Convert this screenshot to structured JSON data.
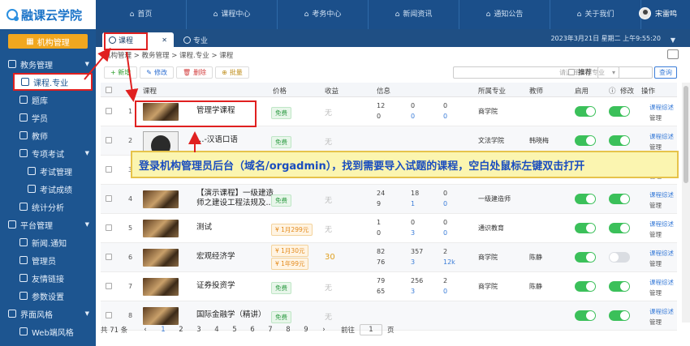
{
  "logo": {
    "text": "融课云学院"
  },
  "topnav": [
    {
      "label": "首页",
      "icon": "home-icon"
    },
    {
      "label": "课程中心",
      "icon": "gear-icon"
    },
    {
      "label": "考务中心",
      "icon": "exam-icon"
    },
    {
      "label": "新闻资讯",
      "icon": "news-icon"
    },
    {
      "label": "通知公告",
      "icon": "chat-icon"
    },
    {
      "label": "关于我们",
      "icon": "info-icon"
    }
  ],
  "user": {
    "name": "宋雷鸣"
  },
  "sidebar": {
    "org_button": "机构管理",
    "items": [
      {
        "label": "教务管理",
        "level": 1,
        "icon": "chart-icon",
        "caret": "▼"
      },
      {
        "label": "课程.专业",
        "level": 2,
        "icon": "book-icon",
        "active": true
      },
      {
        "label": "题库",
        "level": 2,
        "icon": "list-icon"
      },
      {
        "label": "学员",
        "level": 2,
        "icon": "user-icon"
      },
      {
        "label": "教师",
        "level": 2,
        "icon": "teacher-icon"
      },
      {
        "label": "专项考试",
        "level": 2,
        "icon": "exam-icon",
        "caret": "▼"
      },
      {
        "label": "考试管理",
        "level": 3,
        "icon": "doc-icon"
      },
      {
        "label": "考试成绩",
        "level": 3,
        "icon": "score-icon"
      },
      {
        "label": "统计分析",
        "level": 2,
        "icon": "stats-icon"
      },
      {
        "label": "平台管理",
        "level": 1,
        "icon": "list-icon",
        "caret": "▼"
      },
      {
        "label": "新闻.通知",
        "level": 2,
        "icon": "news-icon"
      },
      {
        "label": "管理员",
        "level": 2,
        "icon": "admin-icon"
      },
      {
        "label": "友情链接",
        "level": 2,
        "icon": "link-icon"
      },
      {
        "label": "参数设置",
        "level": 2,
        "icon": "gear-icon"
      },
      {
        "label": "界面风格",
        "level": 1,
        "icon": "ui-icon",
        "caret": "▼"
      },
      {
        "label": "Web端风格",
        "level": 2,
        "icon": "monitor-icon"
      }
    ]
  },
  "tabs": [
    {
      "label": "课程",
      "active": true
    },
    {
      "label": "专业",
      "active": false
    }
  ],
  "datetime": "2023年3月21日 星期二 上午9:55:20",
  "breadcrumb": "机构管理 > 教务管理 > 课程.专业 > 课程",
  "toolbar": {
    "add": "+ 新增",
    "edit": "修改",
    "delete": "删除",
    "batch": "批量",
    "major_placeholder": "请选择课程专业",
    "recommend": "推荐",
    "query": "查询"
  },
  "table": {
    "headers": {
      "course": "课程",
      "price": "价格",
      "income": "收益",
      "info": "信息",
      "major": "所属专业",
      "teacher": "教师",
      "enabled": "启用",
      "edit": "修改",
      "ops": "操作"
    },
    "rows": [
      {
        "no": "1",
        "name": "管理学课程",
        "price": [
          "免费"
        ],
        "price_type": "free",
        "income": "无",
        "s1": "12",
        "s2": "0",
        "s3": "0",
        "s4": "0",
        "s5": "0",
        "s6": "0",
        "major": "商学院",
        "teacher": "",
        "enabled": true,
        "editable": true
      },
      {
        "no": "2",
        "name": "…-汉语口语",
        "price": [
          "免费"
        ],
        "price_type": "free",
        "income": "无",
        "s1": "",
        "s2": "",
        "s3": "",
        "s4": "",
        "s5": "",
        "s6": "",
        "major": "文法学院",
        "teacher": "韩晓梅",
        "enabled": true,
        "editable": true
      },
      {
        "no": "3",
        "name": "",
        "price": [],
        "price_type": "",
        "income": "",
        "s1": "",
        "s2": "",
        "s3": "",
        "s4": "",
        "s5": "",
        "s6": "",
        "major": "",
        "teacher": "",
        "enabled": true,
        "editable": true
      },
      {
        "no": "4",
        "name": "【演示课程】一级建造师之建设工程法规及...",
        "price": [
          "免费"
        ],
        "price_type": "free",
        "income": "无",
        "s1": "24",
        "s2": "9",
        "s3": "18",
        "s4": "1",
        "s5": "0",
        "s6": "0",
        "major": "一级建造师",
        "teacher": "",
        "enabled": true,
        "editable": true
      },
      {
        "no": "5",
        "name": "测试",
        "price": [
          "¥ 1月299元"
        ],
        "price_type": "price",
        "income": "无",
        "s1": "1",
        "s2": "0",
        "s3": "0",
        "s4": "3",
        "s5": "0",
        "s6": "0",
        "major": "通识教育",
        "teacher": "",
        "enabled": true,
        "editable": true
      },
      {
        "no": "6",
        "name": "宏观经济学",
        "price": [
          "¥ 1月30元",
          "¥ 1年99元"
        ],
        "price_type": "price",
        "income": "30",
        "s1": "82",
        "s2": "76",
        "s3": "357",
        "s4": "3",
        "s5": "2",
        "s6": "12k",
        "major": "商学院",
        "teacher": "陈静",
        "enabled": true,
        "editable": false
      },
      {
        "no": "7",
        "name": "证券投资学",
        "price": [
          "免费"
        ],
        "price_type": "free",
        "income": "无",
        "s1": "79",
        "s2": "65",
        "s3": "256",
        "s4": "3",
        "s5": "2",
        "s6": "0",
        "major": "商学院",
        "teacher": "陈静",
        "enabled": true,
        "editable": true
      },
      {
        "no": "8",
        "name": "国际金融学（精讲）",
        "price": [
          "免费"
        ],
        "price_type": "free",
        "income": "无",
        "s1": "",
        "s2": "",
        "s3": "",
        "s4": "",
        "s5": "",
        "s6": "",
        "major": "",
        "teacher": "",
        "enabled": true,
        "editable": true
      }
    ],
    "row_ops": {
      "link": "课程综述",
      "manage": "管理"
    }
  },
  "paging": {
    "total": "共 71 条",
    "pages": [
      "1",
      "2",
      "3",
      "4",
      "5",
      "6",
      "7",
      "8",
      "9"
    ],
    "goto_label": "前往",
    "goto_value": "1",
    "page_suffix": "页"
  },
  "callout": "登录机构管理员后台（域名/orgadmin），找到需要导入试题的课程，空白处鼠标左键双击打开",
  "colors": {
    "accent": "#1d5590",
    "brand_blue": "#1a73c8",
    "annotation_red": "#e02020",
    "toggle_on": "#3bc05a"
  }
}
